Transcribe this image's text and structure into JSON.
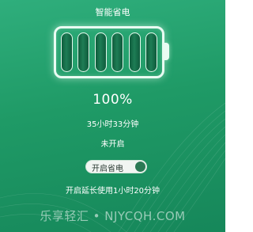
{
  "header": {
    "title": "智能省电"
  },
  "battery": {
    "cells": 6,
    "percent_value": 100,
    "percent_text": "100%",
    "remaining_time": "35小时33分钟"
  },
  "power_saving": {
    "status_text": "未开启",
    "toggle_label": "开启省电",
    "hint_text": "开启延长使用1小时20分钟"
  },
  "watermark": {
    "text": "乐享轻汇 • NJYCQH.COM"
  },
  "colors": {
    "background": "#1f9a66",
    "battery_outline": "#e9fbf2",
    "cell_fill": "#0f5b3c",
    "toggle_knob": "#2b7a55"
  }
}
